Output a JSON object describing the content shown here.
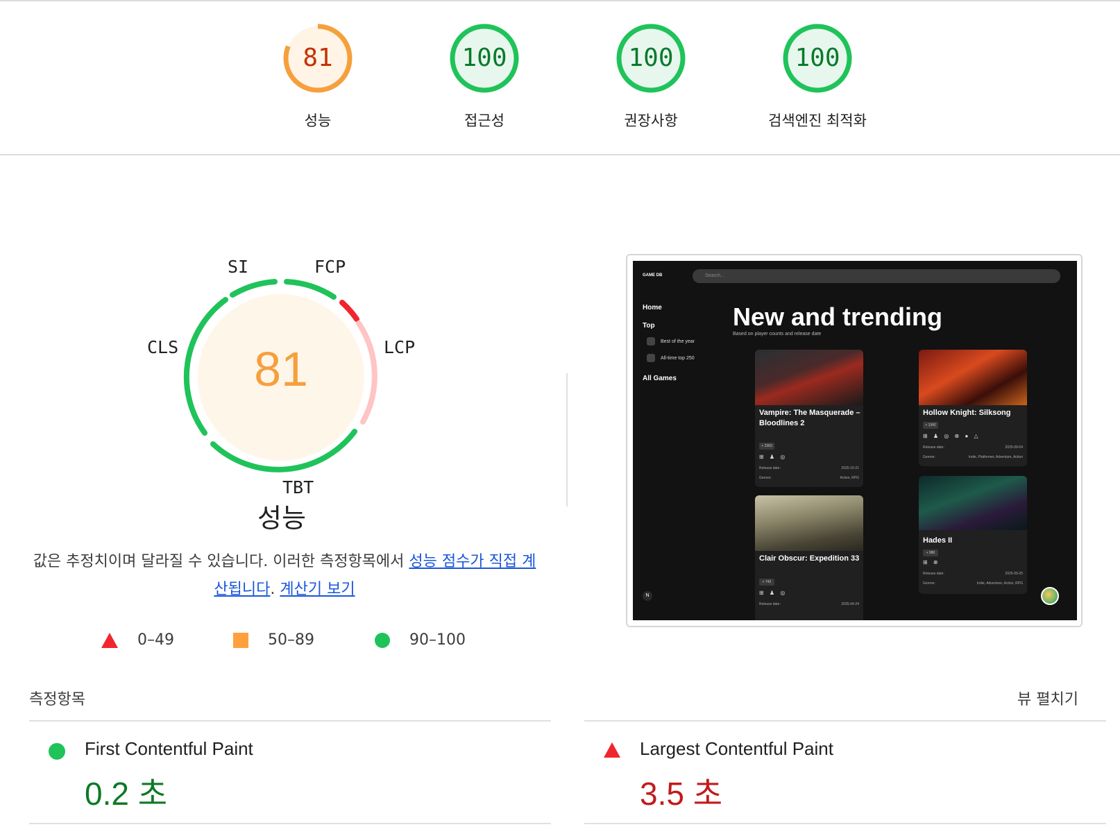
{
  "categories": [
    {
      "score": "81",
      "label": "성능",
      "color": "#f5a03d",
      "text_color": "#c33300",
      "fill": "#fff4e6",
      "fraction": 0.81
    },
    {
      "score": "100",
      "label": "접근성",
      "color": "#1fc35a",
      "text_color": "#0a7a2b",
      "fill": "#e8f7ee",
      "fraction": 1.0
    },
    {
      "score": "100",
      "label": "권장사항",
      "color": "#1fc35a",
      "text_color": "#0a7a2b",
      "fill": "#e8f7ee",
      "fraction": 1.0
    },
    {
      "score": "100",
      "label": "검색엔진 최적화",
      "color": "#1fc35a",
      "text_color": "#0a7a2b",
      "fill": "#e8f7ee",
      "fraction": 1.0
    }
  ],
  "performance": {
    "score": "81",
    "title": "성능",
    "metric_tags": [
      "SI",
      "FCP",
      "LCP",
      "TBT",
      "CLS"
    ]
  },
  "description": {
    "text": "값은 추정치이며 달라질 수 있습니다. 이러한 측정항목에서 ",
    "link1": "성능 점수가 직접 계산됩니다",
    "sep": ". ",
    "link2": "계산기 보기"
  },
  "legend": [
    {
      "shape": "triangle",
      "range": "0–49",
      "color": "#f0262e"
    },
    {
      "shape": "square",
      "range": "50–89",
      "color": "#ffa03c"
    },
    {
      "shape": "circle",
      "range": "90–100",
      "color": "#1fc35a"
    }
  ],
  "screenshot": {
    "logo": "GAME DB",
    "search_placeholder": "Search...",
    "nav": [
      "Home",
      "Top",
      "All Games"
    ],
    "sub_nav": [
      "Best of the year",
      "All-time top 250"
    ],
    "heading": "New and trending",
    "subheading": "Based on player counts and release date",
    "cards": [
      {
        "title": "Vampire: The Masquerade – Bloodlines 2",
        "count": "+ 2363",
        "platforms": "⊞ ♟ ◎",
        "release_label": "Release date:",
        "release": "2025-10-21",
        "genres_label": "Genres:",
        "genres": "Action, RPG"
      },
      {
        "title": "Hollow Knight: Silksong",
        "count": "+ 1342",
        "platforms": "⊞ ♟ ◎ ⊗ ● △",
        "release_label": "Release date:",
        "release": "2025-09-04",
        "genres_label": "Genres:",
        "genres": "Indie, Platformer, Adventure, Action"
      },
      {
        "title": "Clair Obscur: Expedition 33",
        "count": "+ 742",
        "platforms": "⊞ ♟ ◎",
        "release_label": "Release date:",
        "release": "2025-04-24"
      },
      {
        "title": "Hades II",
        "count": "+ 980",
        "platforms": "⊞ ⊗",
        "release_label": "Release date:",
        "release": "2025-09-25",
        "genres_label": "Genres:",
        "genres": "Indie, Adventure, Action, RPG"
      }
    ],
    "n_badge": "N"
  },
  "metrics_section": {
    "label": "측정항목",
    "expand": "뷰 펼치기",
    "items": [
      {
        "name": "First Contentful Paint",
        "value": "0.2 초",
        "status": "good",
        "color": "#0c7a26"
      },
      {
        "name": "Largest Contentful Paint",
        "value": "3.5 초",
        "status": "poor",
        "color": "#c21a1a"
      }
    ]
  }
}
